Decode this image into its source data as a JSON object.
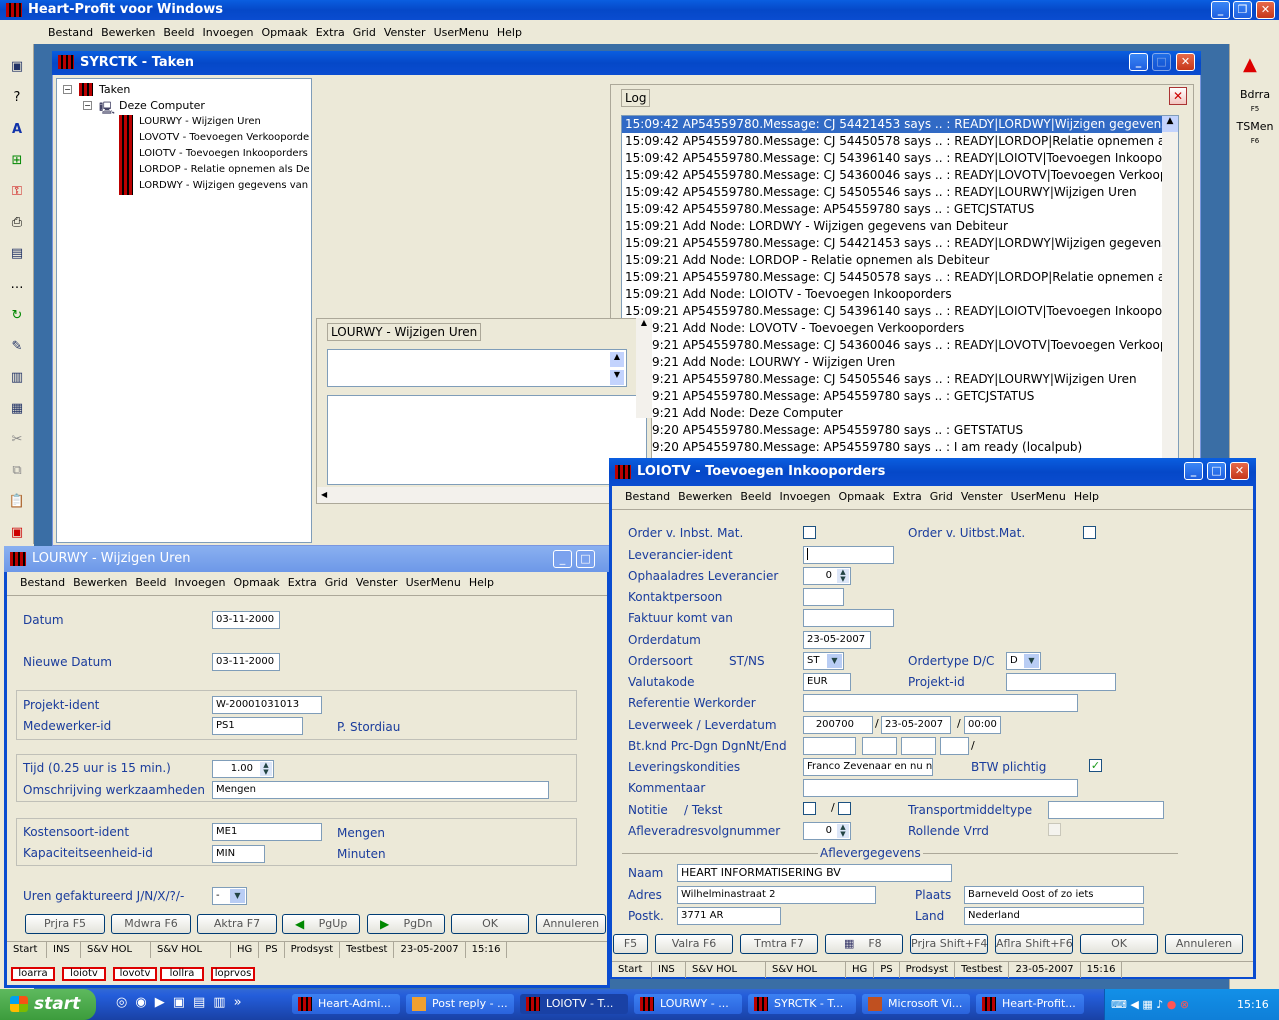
{
  "app": {
    "title": "Heart-Profit voor Windows",
    "menu": [
      "Bestand",
      "Bewerken",
      "Beeld",
      "Invoegen",
      "Opmaak",
      "Extra",
      "Grid",
      "Venster",
      "UserMenu",
      "Help"
    ]
  },
  "toolbar": {
    "icons": [
      "window-icon",
      "help-icon",
      "font-icon",
      "green-plus-icon",
      "key-icon",
      "printer-icon",
      "form-icon",
      "dots-icon",
      "refresh-icon",
      "edit-icon",
      "chart-icon",
      "window2-icon",
      "scissors-icon",
      "copy-icon",
      "paste-icon",
      "clipboard-icon"
    ]
  },
  "right_toolbar": {
    "arrow": "▲",
    "bdrra": "Bdrra",
    "bdrra_key": "F5",
    "tsmen": "TSMen",
    "tsmen_key": "F6"
  },
  "syrctk": {
    "title": "SYRCTK - Taken",
    "tree": {
      "root": "Taken",
      "computer": "Deze Computer",
      "items": [
        "LOURWY - Wijzigen Uren",
        "LOVOTV - Toevoegen Verkooporde",
        "LOIOTV - Toevoegen Inkooporders",
        "LORDOP - Relatie opnemen als Deb",
        "LORDWY - Wijzigen gegevens van"
      ]
    },
    "log_title": "Log",
    "log": [
      "15:09:42 AP54559780.Message: CJ 54421453 says .. : READY|LORDWY|Wijzigen gegevens van D",
      "15:09:42 AP54559780.Message: CJ 54450578 says .. : READY|LORDOP|Relatie opnemen als Deb",
      "15:09:42 AP54559780.Message: CJ 54396140 says .. : READY|LOIOTV|Toevoegen Inkooporders",
      "15:09:42 AP54559780.Message: CJ 54360046 says .. : READY|LOVOTV|Toevoegen Verkooporders",
      "15:09:42 AP54559780.Message: CJ 54505546 says .. : READY|LOURWY|Wijzigen Uren",
      "15:09:42 AP54559780.Message: AP54559780 says .. : GETCJSTATUS",
      "15:09:21 Add Node: LORDWY - Wijzigen gegevens van Debiteur",
      "15:09:21 AP54559780.Message: CJ 54421453 says .. : READY|LORDWY|Wijzigen gegevens van D",
      "15:09:21 Add Node: LORDOP - Relatie opnemen als Debiteur",
      "15:09:21 AP54559780.Message: CJ 54450578 says .. : READY|LORDOP|Relatie opnemen als Deb",
      "15:09:21 Add Node: LOIOTV - Toevoegen Inkooporders",
      "15:09:21 AP54559780.Message: CJ 54396140 says .. : READY|LOIOTV|Toevoegen Inkooporders",
      "15:09:21 Add Node: LOVOTV - Toevoegen Verkooporders",
      "15:09:21 AP54559780.Message: CJ 54360046 says .. : READY|LOVOTV|Toevoegen Verkooporders",
      "15:09:21 Add Node: LOURWY - Wijzigen Uren",
      "15:09:21 AP54559780.Message: CJ 54505546 says .. : READY|LOURWY|Wijzigen Uren",
      "15:09:21 AP54559780.Message: AP54559780 says .. : GETCJSTATUS",
      "15:09:21 Add Node: Deze Computer",
      "15:09:20 AP54559780.Message: AP54559780 says .. : GETSTATUS",
      "15:09:20 AP54559780.Message: AP54559780 says .. : I am ready (localpub)"
    ],
    "detail_title": "LOURWY - Wijzigen Uren"
  },
  "lourwy": {
    "title": "LOURWY - Wijzigen Uren",
    "menu": [
      "Bestand",
      "Bewerken",
      "Beeld",
      "Invoegen",
      "Opmaak",
      "Extra",
      "Grid",
      "Venster",
      "UserMenu",
      "Help"
    ],
    "datum_label": "Datum",
    "datum": "03-11-2000",
    "nieuwe_datum_label": "Nieuwe Datum",
    "nieuwe_datum": "03-11-2000",
    "projekt_label": "Projekt-ident",
    "projekt": "W-20001031013",
    "medewerker_label": "Medewerker-id",
    "medewerker": "PS1",
    "medewerker_naam": "P. Stordiau",
    "tijd_label": "Tijd (0.25 uur is 15 min.)",
    "tijd": "1.00",
    "omschrijving_label": "Omschrijving werkzaamheden",
    "omschrijving": "Mengen",
    "kostensoort_label": "Kostensoort-ident",
    "kostensoort": "ME1",
    "kostensoort_naam": "Mengen",
    "kapaciteit_label": "Kapaciteitseenheid-id",
    "kapaciteit": "MIN",
    "kapaciteit_naam": "Minuten",
    "uren_label": "Uren gefaktureerd J/N/X/?/-",
    "uren": "-",
    "buttons": [
      "Prjra   F5",
      "Mdwra   F6",
      "Aktra   F7",
      "PgUp",
      "PgDn",
      "OK",
      "Annuleren"
    ],
    "status": [
      "Start",
      "INS",
      "S&V HOL",
      "S&V HOL",
      "HG",
      "PS",
      "Prodsyst",
      "Testbest",
      "23-05-2007",
      "15:16"
    ]
  },
  "loiotv": {
    "title": "LOIOTV - Toevoegen Inkooporders",
    "menu": [
      "Bestand",
      "Bewerken",
      "Beeld",
      "Invoegen",
      "Opmaak",
      "Extra",
      "Grid",
      "Venster",
      "UserMenu",
      "Help"
    ],
    "order_inbst": "Order v. Inbst. Mat.",
    "order_uitbst": "Order v. Uitbst.Mat.",
    "leverancier": "Leverancier-ident",
    "ophaaladres": "Ophaaladres Leverancier",
    "ophaaladres_val": "0",
    "kontakt": "Kontaktpersoon",
    "faktuur": "Faktuur komt van",
    "orderdatum": "Orderdatum",
    "orderdatum_val": "23-05-2007",
    "ordersoort": "Ordersoort",
    "stns": "ST/NS",
    "ordersoort_val": "ST",
    "ordertype": "Ordertype D/C",
    "ordertype_val": "D",
    "valutakode": "Valutakode",
    "valutakode_val": "EUR",
    "projekt": "Projekt-id",
    "referentie": "Referentie Werkorder",
    "leverweek": "Leverweek / Leverdatum",
    "leverweek_val": "200700",
    "leverdatum_val": "23-05-2007",
    "levertijd_val": "00:00",
    "btknd": "Bt.knd Prc-Dgn DgnNt/End",
    "leveringskond": "Leveringskondities",
    "leveringskond_val": "Franco Zevenaar en nu nog",
    "btw": "BTW plichtig",
    "kommentaar": "Kommentaar",
    "notitie": "Notitie",
    "tekst": "/ Tekst",
    "transport": "Transportmiddeltype",
    "afleveradres": "Afleveradresvolgnummer",
    "afleveradres_val": "0",
    "rollende": "Rollende Vrrd",
    "aflevergegevens": "Aflevergegevens",
    "naam_label": "Naam",
    "naam": "HEART INFORMATISERING BV",
    "adres_label": "Adres",
    "adres": "Wilhelminastraat 2",
    "plaats_label": "Plaats",
    "plaats": "Barneveld Oost of zo iets",
    "postk_label": "Postk.",
    "postk": "3771 AR",
    "land_label": "Land",
    "land": "Nederland",
    "buttons": [
      "F5",
      "Valra   F6",
      "Tmtra   F7",
      "F8",
      "Prjra   Shift+F4",
      "Aflra   Shift+F6",
      "OK",
      "Annuleren"
    ],
    "status": [
      "Start",
      "INS",
      "S&V HOL",
      "S&V HOL",
      "HG",
      "PS",
      "Prodsyst",
      "Testbest",
      "23-05-2007",
      "15:16"
    ]
  },
  "bottom_tabs": [
    "loarra",
    "loiotv",
    "lovotv",
    "lollra",
    "loprvos"
  ],
  "taskbar": {
    "start": "start",
    "tasks": [
      "Heart-Admi...",
      "Post reply - ...",
      "LOIOTV - T...",
      "LOURWY - ...",
      "SYRCTK - T...",
      "Microsoft Vi...",
      "Heart-Profit..."
    ],
    "clock": "15:16"
  },
  "colors": {
    "xp_blue": "#0548c8",
    "label_blue": "#1a3c9c",
    "taskbar": "#245edb",
    "start_green": "#3c9c3c"
  }
}
